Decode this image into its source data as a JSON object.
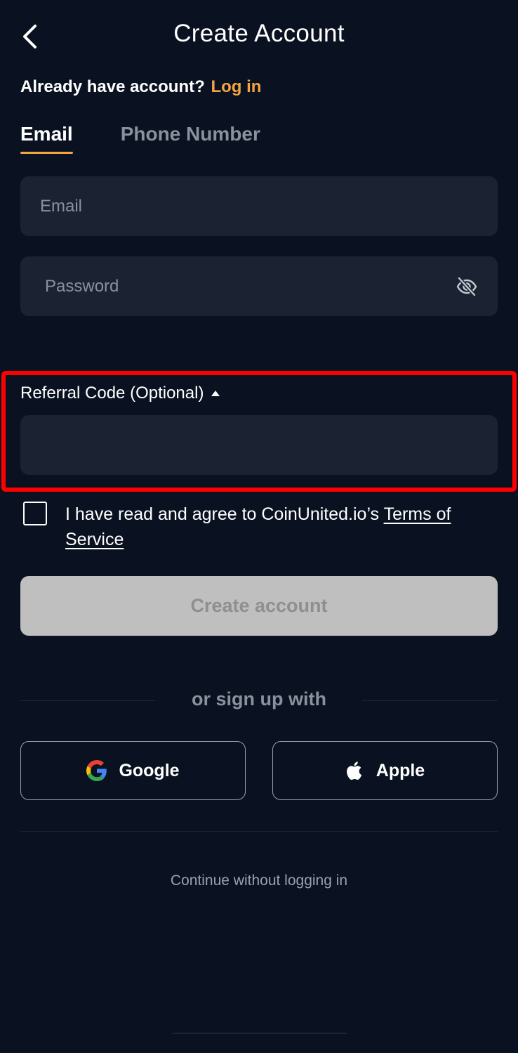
{
  "header": {
    "title": "Create Account",
    "back_icon": "chevron-left-icon"
  },
  "login_prompt": {
    "text": "Already have account?",
    "link": "Log in"
  },
  "tabs": [
    {
      "label": "Email",
      "active": true
    },
    {
      "label": "Phone Number",
      "active": false
    }
  ],
  "form": {
    "email_placeholder": "Email",
    "email_value": "",
    "password_placeholder": "Password",
    "password_value": "",
    "password_toggle_icon": "eye-slash-icon",
    "referral_label": "Referral Code (Optional)",
    "referral_value": "",
    "terms_prefix": "I have read and agree to CoinUnited.io’s ",
    "terms_link": "Terms of Service",
    "terms_checked": false,
    "submit_label": "Create account"
  },
  "social": {
    "divider_text": "or sign up with",
    "google_label": "Google",
    "apple_label": "Apple"
  },
  "footer": {
    "continue_text": "Continue without logging in"
  },
  "colors": {
    "background": "#0a1221",
    "input_bg": "#1b2232",
    "accent": "#f5a442",
    "highlight": "#ff0000",
    "disabled_button": "#bfbfbf"
  }
}
